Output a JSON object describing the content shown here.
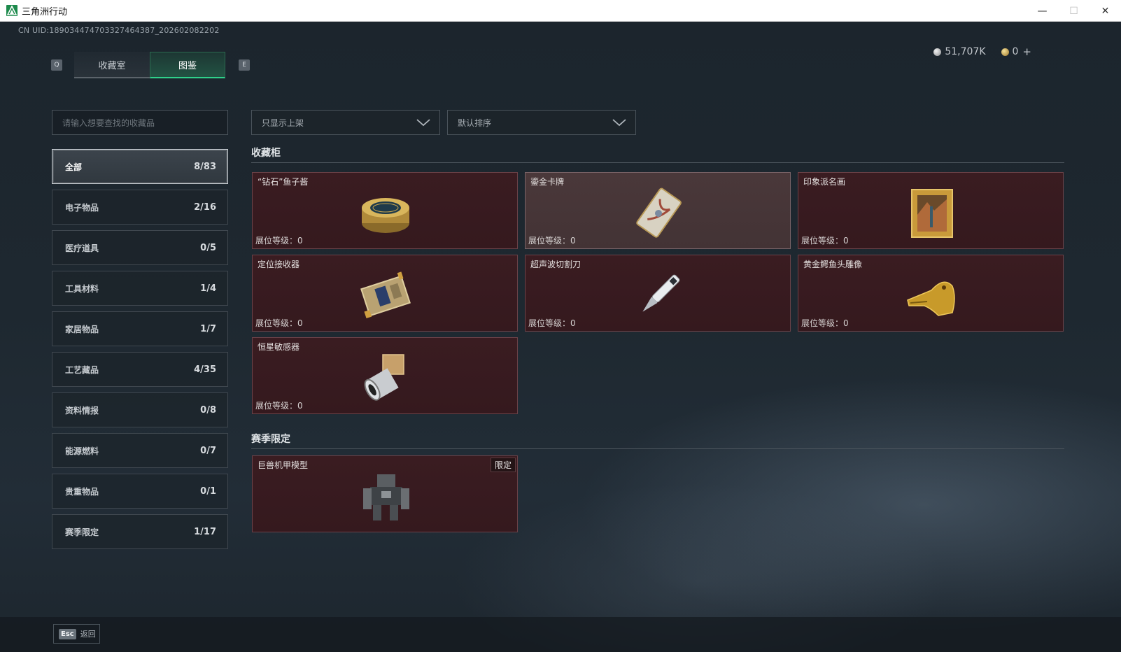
{
  "window": {
    "title": "三角洲行动",
    "minimize": "—",
    "maximize": "☐",
    "close": "✕"
  },
  "header": {
    "uid": "CN UID:18903447470332746438​7_202602082202",
    "tabs": [
      {
        "label": "收藏室",
        "key": "Q",
        "active": false
      },
      {
        "label": "图鉴",
        "key": "E",
        "active": true
      }
    ],
    "key_left": "Q",
    "key_right": "E",
    "currency": [
      {
        "icon": "silver-coin-icon",
        "value": "51,707K"
      },
      {
        "icon": "gold-coin-icon",
        "value": "0"
      }
    ],
    "currency_add": "+"
  },
  "sidebar": {
    "search_placeholder": "请输入想要查找的收藏品",
    "categories": [
      {
        "label": "全部",
        "count": "8/83",
        "active": true
      },
      {
        "label": "电子物品",
        "count": "2/16"
      },
      {
        "label": "医疗道具",
        "count": "0/5"
      },
      {
        "label": "工具材料",
        "count": "1/4"
      },
      {
        "label": "家居物品",
        "count": "1/7"
      },
      {
        "label": "工艺藏品",
        "count": "4/35"
      },
      {
        "label": "资料情报",
        "count": "0/8"
      },
      {
        "label": "能源燃料",
        "count": "0/7"
      },
      {
        "label": "贵重物品",
        "count": "0/1"
      },
      {
        "label": "赛季限定",
        "count": "1/17"
      }
    ]
  },
  "filters": {
    "filter_value": "只显示上架",
    "sort_value": "默认排序"
  },
  "sections": {
    "cabinet_title": "收藏柜",
    "season_title": "赛季限定"
  },
  "level_label": "展位等级：",
  "items": [
    {
      "name": "“钻石”鱼子酱",
      "level": "0",
      "icon": "caviar-tin-icon"
    },
    {
      "name": "鎏金卡牌",
      "level": "0",
      "icon": "gilded-card-icon"
    },
    {
      "name": "印象派名画",
      "level": "0",
      "icon": "framed-painting-icon"
    },
    {
      "name": "定位接收器",
      "level": "0",
      "icon": "gps-receiver-icon"
    },
    {
      "name": "超声波切割刀",
      "level": "0",
      "icon": "ultrasonic-knife-icon"
    },
    {
      "name": "黄金鳄鱼头雕像",
      "level": "0",
      "icon": "gold-crocodile-head-icon"
    },
    {
      "name": "恒星敏感器",
      "level": "0",
      "icon": "star-sensor-icon"
    }
  ],
  "season_items": [
    {
      "name": "巨兽机甲模型",
      "badge": "限定",
      "icon": "mech-model-icon"
    }
  ],
  "footer": {
    "esc_key": "Esc",
    "back_label": "返回"
  },
  "colors": {
    "accent": "#2fd18a",
    "card_bg": "#3a1c21",
    "card_highlight": "#4a383a"
  }
}
